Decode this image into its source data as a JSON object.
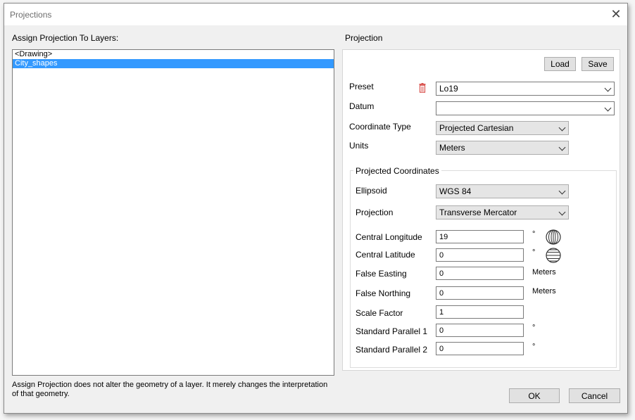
{
  "window": {
    "title": "Projections",
    "close_glyph": "✕"
  },
  "layers": {
    "label": "Assign Projection To Layers:",
    "items": [
      {
        "label": "<Drawing>",
        "selected": false
      },
      {
        "label": "City_shapes",
        "selected": true
      }
    ],
    "footnote": "Assign Projection does not alter the geometry of a layer. It merely changes the interpretation of that geometry."
  },
  "projection": {
    "label": "Projection",
    "load_label": "Load",
    "save_label": "Save",
    "preset": {
      "label": "Preset",
      "value": "Lo19"
    },
    "datum": {
      "label": "Datum",
      "value": ""
    },
    "coordinate_type": {
      "label": "Coordinate Type",
      "value": "Projected Cartesian"
    },
    "units": {
      "label": "Units",
      "value": "Meters"
    },
    "projected": {
      "group_label": "Projected Coordinates",
      "ellipsoid": {
        "label": "Ellipsoid",
        "value": "WGS 84"
      },
      "projection": {
        "label": "Projection",
        "value": "Transverse Mercator"
      },
      "central_longitude": {
        "label": "Central Longitude",
        "value": "19",
        "unit": "°"
      },
      "central_latitude": {
        "label": "Central Latitude",
        "value": "0",
        "unit": "°"
      },
      "false_easting": {
        "label": "False Easting",
        "value": "0",
        "unit": "Meters"
      },
      "false_northing": {
        "label": "False Northing",
        "value": "0",
        "unit": "Meters"
      },
      "scale_factor": {
        "label": "Scale Factor",
        "value": "1"
      },
      "standard_parallel_1": {
        "label": "Standard Parallel 1",
        "value": "0",
        "unit": "°"
      },
      "standard_parallel_2": {
        "label": "Standard Parallel 2",
        "value": "0",
        "unit": "°"
      }
    }
  },
  "footer": {
    "ok_label": "OK",
    "cancel_label": "Cancel"
  },
  "colors": {
    "selection": "#3399ff",
    "trash_icon": "#d9534f"
  },
  "icons": {
    "trash": "trash-icon",
    "longitude": "globe-longitude-icon",
    "latitude": "globe-latitude-icon",
    "dropdown": "chevron-down-icon"
  }
}
